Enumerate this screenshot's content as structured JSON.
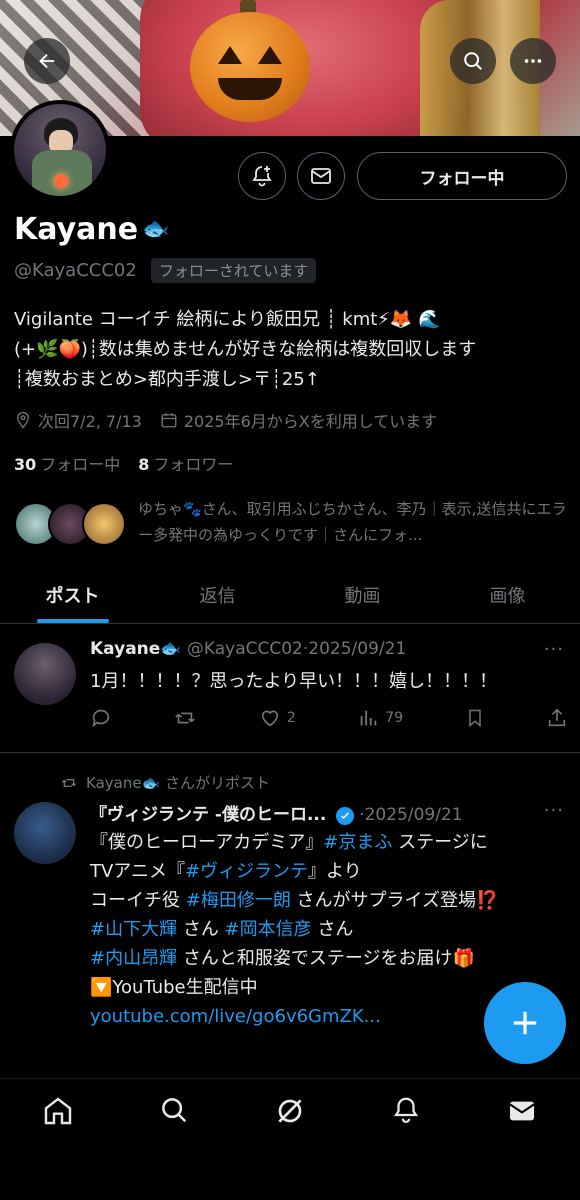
{
  "header": {
    "icons": [
      "back-arrow-icon",
      "search-icon",
      "more-icon"
    ]
  },
  "profile": {
    "name": "Kayane",
    "name_emoji": "🐟",
    "handle": "@KayaCCC02",
    "follows_you": "フォローされています",
    "follow_button": "フォロー中",
    "bio_lines": [
      "Vigilante コーイチ 絵柄により飯田兄 ┊ kmt⚡🦊 🌊",
      "(+🌿🍑)┊数は集めませんが好きな絵柄は複数回収します",
      "┊複数おまとめ>都内手渡し>〒┊25↑"
    ],
    "location": "次回7/2, 7/13",
    "joined": "2025年6月からXを利用しています",
    "following_count": "30",
    "following_label": "フォロー中",
    "followers_count": "8",
    "followers_label": "フォロワー",
    "followed_by": "ゆちゃ🐾さん、取引用ふじちかさん、李乃｜表示,送信共にエラー多発中の為ゆっくりです｜さんにフォ..."
  },
  "tabs": [
    "ポスト",
    "返信",
    "動画",
    "画像"
  ],
  "posts": [
    {
      "author": "Kayane🐟",
      "handle": "@KayaCCC02",
      "date": "2025/09/21",
      "text": "1月！！！！？思ったより早い！！！嬉し！！！！",
      "likes": "2",
      "views": "79"
    },
    {
      "repost_label": "Kayane🐟 さんがリポスト",
      "author": "『ヴィジランテ -僕のヒーロ...",
      "date": "2025/09/21",
      "lines": [
        {
          "parts": [
            {
              "t": "『僕のヒーローアカデミア』"
            },
            {
              "t": "#京まふ",
              "link": true
            },
            {
              "t": " ステージに"
            }
          ]
        },
        {
          "parts": [
            {
              "t": "TVアニメ『"
            },
            {
              "t": "#ヴィジランテ",
              "link": true
            },
            {
              "t": "』より"
            }
          ]
        },
        {
          "parts": [
            {
              "t": "コーイチ役 "
            },
            {
              "t": "#梅田修一朗",
              "link": true
            },
            {
              "t": " さんがサプライズ登場⁉️"
            }
          ]
        },
        {
          "parts": [
            {
              "t": " "
            }
          ]
        },
        {
          "parts": [
            {
              "t": "#山下大輝",
              "link": true
            },
            {
              "t": " さん "
            },
            {
              "t": "#岡本信彦",
              "link": true
            },
            {
              "t": " さん"
            }
          ]
        },
        {
          "parts": [
            {
              "t": "#内山昂輝",
              "link": true
            },
            {
              "t": " さんと和服姿でステージをお届け🎁"
            }
          ]
        },
        {
          "parts": [
            {
              "t": " "
            }
          ]
        },
        {
          "parts": [
            {
              "t": "🔽YouTube生配信中"
            }
          ]
        },
        {
          "parts": [
            {
              "t": "youtube.com/live/go6v6GmZK...",
              "link": true
            }
          ]
        }
      ]
    }
  ],
  "nav": [
    "home-icon",
    "search-icon",
    "grok-icon",
    "notifications-icon",
    "messages-icon"
  ],
  "colors": {
    "accent": "#1d9bf0",
    "muted": "#71767b",
    "background": "#000000"
  }
}
